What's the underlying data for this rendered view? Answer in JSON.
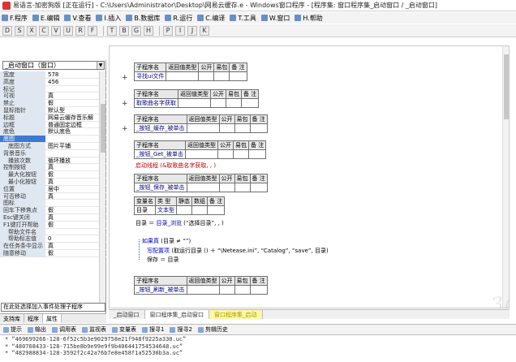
{
  "window": {
    "title": "易语言-加密狗版 [正在运行] - C:\\Users\\Administrator\\Desktop\\网易云缓存.e - Windows窗口程序 - [程序集: 窗口程序集_启动窗口 / _启动窗口]"
  },
  "menu": [
    "F.程序",
    "E.编辑",
    "V.查看",
    "I.插入",
    "B.数据库",
    "R.运行",
    "C.编译",
    "T.工具",
    "W.窗口",
    "H.帮助"
  ],
  "toolbar": [
    "D",
    "S",
    "X",
    "C",
    "V",
    "U",
    "R",
    "F",
    "T",
    "B",
    "G",
    "H",
    "P",
    "I",
    "J",
    "K"
  ],
  "left_panel": {
    "combo": "_启动窗口（窗口）",
    "properties": [
      {
        "name": "宽度",
        "value": "578"
      },
      {
        "name": "高度",
        "value": "456"
      },
      {
        "name": "标记",
        "value": ""
      },
      {
        "name": "可视",
        "value": "真"
      },
      {
        "name": "禁止",
        "value": "假"
      },
      {
        "name": "鼠标指针",
        "value": "默认型"
      },
      {
        "name": "标题",
        "value": "网易云缓存音乐解"
      },
      {
        "name": "边框",
        "value": "普通固定边框"
      },
      {
        "name": "底色",
        "value": "默认底色"
      },
      {
        "name": "底图",
        "value": "",
        "selected": true
      },
      {
        "name": "底图方式",
        "value": "图片平铺",
        "sub": true
      },
      {
        "name": "背景音乐",
        "value": ""
      },
      {
        "name": "播放次数",
        "value": "循环播放",
        "sub": true
      },
      {
        "name": "控制按钮",
        "value": "真"
      },
      {
        "name": "最大化按钮",
        "value": "假",
        "sub": true
      },
      {
        "name": "最小化按钮",
        "value": "真",
        "sub": true
      },
      {
        "name": "位置",
        "value": "居中"
      },
      {
        "name": "可否移动",
        "value": "真"
      },
      {
        "name": "图标",
        "value": ""
      },
      {
        "name": "回车下移焦点",
        "value": "假"
      },
      {
        "name": "Esc键关闭",
        "value": "真"
      },
      {
        "name": "F1键打开帮助",
        "value": "假"
      },
      {
        "name": "帮助文件名",
        "value": "",
        "sub": true
      },
      {
        "name": "帮助标志值",
        "value": "0",
        "sub": true
      },
      {
        "name": "在任务条中显示",
        "value": "真"
      },
      {
        "name": "随意移动",
        "value": "假"
      }
    ],
    "event_combo": "在此处选择加入事件处理子程序",
    "tabs": [
      "支持库",
      "程序",
      "属性"
    ]
  },
  "editor": {
    "header": {
      "name": "子程序名",
      "ret": "返回值类型",
      "public": "公开",
      "easy": "易包",
      "note": "备 注"
    },
    "subs": [
      "寻找ui文件",
      "取歌曲名字获取",
      "_按钮_缓存_被单击",
      "_按钮_Get_被单击",
      "_按钮_保存_被单击",
      "_按钮_刷新_被单击"
    ],
    "call_line": "启动线程 (&取歌曲名字获取, , )",
    "var_header": {
      "name": "变量名",
      "type": "类 型",
      "static": "静态",
      "array": "数组",
      "note": "备 注"
    },
    "var_row": {
      "name": "目录",
      "type": "文本型"
    },
    "code": {
      "line1a": "目录 ＝ ",
      "line1b": "目录_浏览",
      "line1c": " (“选择目录”, , )",
      "if_kw": "如果真",
      "if_rest": " (目录 ≠ “”)",
      "write_fn": "写配置项",
      "write_rest": " (取运行目录 () ＋ “\\Netease.ini”, “Catalog”, “save”, 目录)",
      "save": "保存 ＝ 目录"
    },
    "tabs": [
      "_启动窗口",
      "窗口程序集_启动窗口",
      "窗口程序集_启动"
    ]
  },
  "output_bar": [
    "提示",
    "输出",
    "调用表",
    "监视表",
    "变量表",
    "搜寻1",
    "搜寻2",
    "剪辑历史"
  ],
  "output_lines": [
    "* “469699266-128-6f52c5b3e9029758e21f948f9225a330.uc”",
    "* “480768433-128-715be8b9e99e9f9b406441754534648.uc”",
    "* “482988834-128-3592f2c42a76b7e8e458f1a52530b3a.uc”"
  ],
  "watermark": "3qyun"
}
